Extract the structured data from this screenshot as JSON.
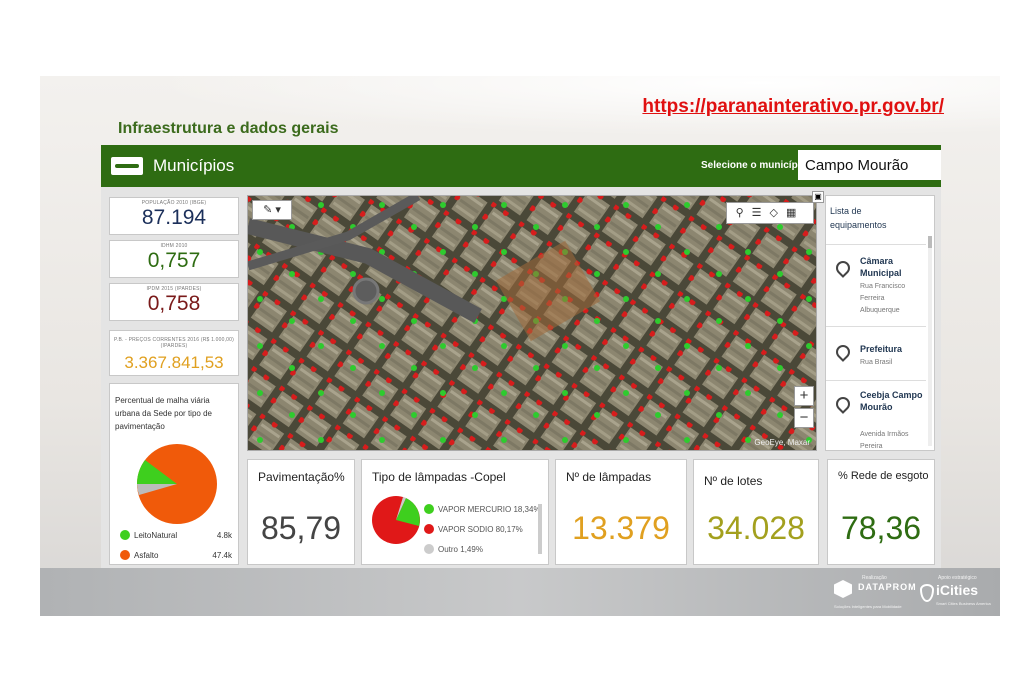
{
  "slide": {
    "title": "Infraestrutura e dados gerais",
    "url": "https://paranainterativo.pr.gov.br/"
  },
  "header": {
    "title": "Municípios",
    "municipality_label": "Selecione o município",
    "municipality_value": "Campo Mourão"
  },
  "kpis": [
    {
      "label": "POPULAÇÃO 2010 (IBGE)",
      "value": "87.194",
      "color": "#1b2f5a"
    },
    {
      "label": "IDHM 2010",
      "value": "0,757",
      "color": "#2e6c12"
    },
    {
      "label": "IPDM 2015 (IPARDES)",
      "value": "0,758",
      "color": "#7a1a1a"
    },
    {
      "label": "P.B. - PREÇOS CORRENTES 2016 (R$ 1.000,00) (IPARDES)",
      "value": "3.367.841,53",
      "color": "#e0a020"
    }
  ],
  "paving": {
    "title": "Percentual de malha viária urbana da Sede por tipo de pavimentação",
    "legend": [
      {
        "label": "LeitoNatural",
        "value": "4.8k",
        "color": "#3ecf1e"
      },
      {
        "label": "Asfalto",
        "value": "47.4k",
        "color": "#f05a0a"
      }
    ]
  },
  "map": {
    "credit": "GeoEye, Maxar",
    "zoom_in": "+",
    "zoom_out": "−"
  },
  "equipment": {
    "title": "Lista de equipamentos",
    "items": [
      {
        "name": "Câmara Municipal",
        "address": "Rua Francisco Ferreira Albuquerque"
      },
      {
        "name": "Prefeitura",
        "address": "Rua Brasil"
      },
      {
        "name": "Ceebja Campo Mourão",
        "address": "Avenida Irmãos Pereira"
      }
    ]
  },
  "stats": {
    "pavimentacao": {
      "label": "Pavimentação%",
      "value": "85,79",
      "color": "#444444"
    },
    "lampadas_tipo": {
      "label": "Tipo de lâmpadas  -Copel",
      "legend": [
        {
          "label": "VAPOR MERCURIO",
          "value": "18,34%",
          "color": "#3ecf1e"
        },
        {
          "label": "VAPOR SODIO",
          "value": "80,17%",
          "color": "#e01818"
        },
        {
          "label": "Outro",
          "value": "1,49%",
          "color": "#cccccc"
        }
      ]
    },
    "lampadas_num": {
      "label": "Nº de lâmpadas",
      "value": "13.379",
      "color": "#e0a020"
    },
    "lotes": {
      "label": "Nº de lotes",
      "value": "34.028",
      "color": "#a3a01e"
    },
    "esgoto": {
      "label": "% Rede de esgoto",
      "value": "78,36",
      "color": "#2e6c12"
    }
  },
  "footer": {
    "dataprom_label": "Realização",
    "dataprom_name": "DATAPROM",
    "dataprom_sub": "Soluções Inteligentes para Mobilidade",
    "icities_label": "Apoio estratégico",
    "icities_name": "iCities",
    "icities_sub": "Smart Cities Business America"
  }
}
